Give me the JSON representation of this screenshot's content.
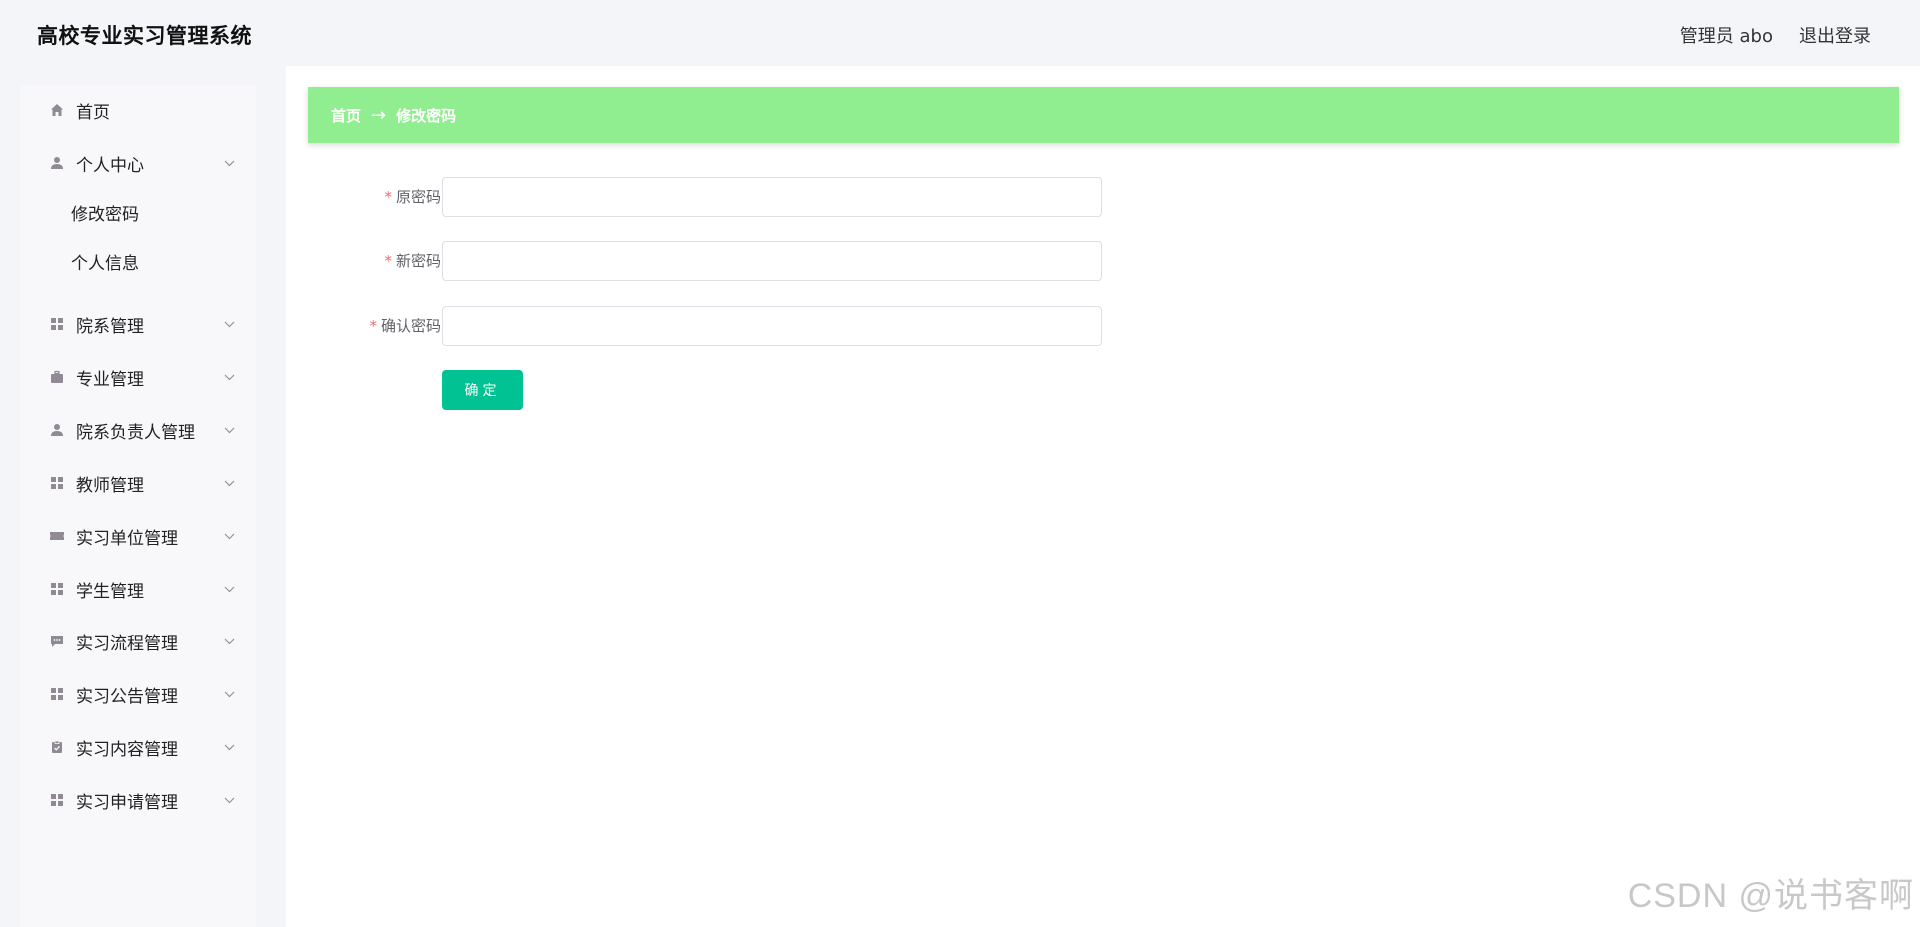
{
  "app_title": "高校专业实习管理系统",
  "header": {
    "user_label": "管理员 abo",
    "logout_label": "退出登录"
  },
  "sidebar": {
    "items": [
      {
        "label": "首页",
        "icon": "home-icon"
      },
      {
        "label": "个人中心",
        "icon": "user-icon",
        "expanded": true,
        "children": [
          {
            "label": "修改密码"
          },
          {
            "label": "个人信息"
          }
        ]
      },
      {
        "label": "院系管理",
        "icon": "grid-icon"
      },
      {
        "label": "专业管理",
        "icon": "briefcase-icon"
      },
      {
        "label": "院系负责人管理",
        "icon": "user-icon"
      },
      {
        "label": "教师管理",
        "icon": "grid-icon"
      },
      {
        "label": "实习单位管理",
        "icon": "ticket-icon"
      },
      {
        "label": "学生管理",
        "icon": "grid-icon"
      },
      {
        "label": "实习流程管理",
        "icon": "chat-icon"
      },
      {
        "label": "实习公告管理",
        "icon": "grid-icon"
      },
      {
        "label": "实习内容管理",
        "icon": "clipboard-icon"
      },
      {
        "label": "实习申请管理",
        "icon": "grid-icon"
      }
    ]
  },
  "breadcrumb": {
    "home": "首页",
    "arrow": "→",
    "current": "修改密码"
  },
  "form": {
    "old_password_label": "原密码",
    "new_password_label": "新密码",
    "confirm_password_label": "确认密码",
    "required_mark": "*",
    "old_password_value": "",
    "new_password_value": "",
    "confirm_password_value": "",
    "submit_label": "确定"
  },
  "watermark": "CSDN @说书客啊",
  "colors": {
    "breadcrumb_bg": "#90ee90",
    "primary_button": "#00c292",
    "required_star": "#f56c6c"
  }
}
